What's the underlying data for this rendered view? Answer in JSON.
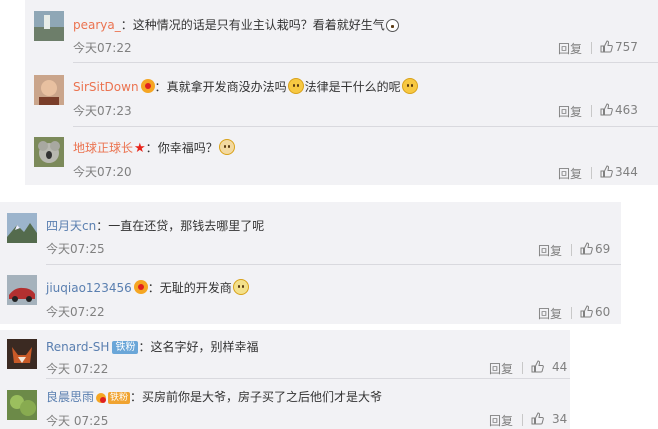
{
  "colors": {
    "username": "#eb7350",
    "meta": "#808080",
    "panel": "#f2f2f5"
  },
  "comments": [
    {
      "user": "pearya_",
      "colon": "：",
      "text": "这种情况的话是只有业主认栽吗？看着就好生气",
      "time": "今天07:22",
      "reply": "回复",
      "likes": "757",
      "avatar": "avatar-photo-street"
    },
    {
      "user": "SirSitDown",
      "colon": "：",
      "text_parts": [
        "真就拿开发商没办法吗",
        "法律是干什么的呢"
      ],
      "time": "今天07:23",
      "reply": "回复",
      "likes": "463",
      "avatar": "avatar-photo-portrait"
    },
    {
      "user": "地球正球长",
      "colon": "：",
      "text": "你幸福吗？",
      "time": "今天07:20",
      "reply": "回复",
      "likes": "344",
      "avatar": "avatar-photo-koala"
    },
    {
      "user": "四月天cn",
      "colon": "：",
      "text": "一直在还贷，那钱去哪里了呢",
      "time": "今天07:25",
      "reply": "回复",
      "likes": "69",
      "avatar": "avatar-photo-mountain"
    },
    {
      "user": "jiuqiao123456",
      "colon": "：",
      "text": "无耻的开发商",
      "time": "今天07:22",
      "reply": "回复",
      "likes": "60",
      "avatar": "avatar-photo-car"
    },
    {
      "user": "Renard-SH",
      "tag": "铁粉",
      "colon": "：",
      "text": "这名字好，别样幸福",
      "time": "今天 07:22",
      "reply": "回复",
      "likes": "44",
      "avatar": "avatar-photo-fox"
    },
    {
      "user": "良晨思雨",
      "tag": "铁粉",
      "colon": "：",
      "text": "买房前你是大爷，房子买了之后他们才是大爷",
      "time": "今天 07:25",
      "reply": "回复",
      "likes": "34",
      "avatar": "avatar-photo-plant"
    }
  ]
}
